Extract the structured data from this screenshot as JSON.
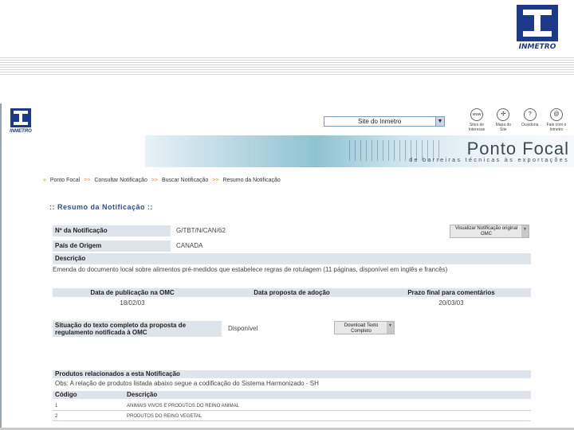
{
  "slide": {
    "logo_text": "INMETRO"
  },
  "site": {
    "logo_text": "INMETRO",
    "select_value": "Site do Inmetro",
    "topnav": [
      {
        "icon": "www-icon",
        "glyph": "www",
        "label": "Sites de Interesse"
      },
      {
        "icon": "map-icon",
        "glyph": "✣",
        "label": "Mapa do Site"
      },
      {
        "icon": "question-icon",
        "glyph": "?",
        "label": "Ouvidoria"
      },
      {
        "icon": "at-icon",
        "glyph": "@",
        "label": "Fale com o Inmetro"
      }
    ],
    "banner_title": "Ponto Focal",
    "banner_subtitle": "de barreiras técnicas às exportações"
  },
  "breadcrumb": [
    "Ponto Focal",
    "Consultar Notificação",
    "Buscar Notificação",
    "Resumo da Notificação"
  ],
  "breadcrumb_sep": ">>",
  "section_title": ":: Resumo da Notificação ::",
  "fields": {
    "numero_label": "Nº da Notificação",
    "numero_value": "G/TBT/N/CAN/62",
    "pais_label": "País de Origem",
    "pais_value": "CANADA",
    "descricao_label": "Descrição",
    "descricao_value": "Emenda do documento local sobre alimentos pré-medidos que estabelece regras de rotulagem (11 páginas, disponível em inglês e francês)"
  },
  "buttons": {
    "visualizar": "Visualizar Notificação original OMC",
    "download": "Download Texto Completo"
  },
  "dates": {
    "publicacao_label": "Data de publicação na OMC",
    "adocao_label": "Data proposta de adoção",
    "prazo_label": "Prazo final para comentários",
    "publicacao_value": "18/02/03",
    "adocao_value": "",
    "prazo_value": "20/03/03"
  },
  "situacao": {
    "label": "Situação do texto completo da proposta de regulamento notificada à OMC",
    "value": "Disponível"
  },
  "produtos": {
    "heading": "Produtos relacionados a esta Notificação",
    "obs": "Obs: A relação de produtos listada abaixo segue a codificação do Sistema Harmonizado - SH",
    "col_codigo": "Código",
    "col_descricao": "Descrição",
    "rows": [
      {
        "codigo": "1",
        "descricao": "ANIMAIS VIVOS E PRODUTOS DO REINO ANIMAL"
      },
      {
        "codigo": "2",
        "descricao": "PRODUTOS DO REINO VEGETAL"
      }
    ]
  }
}
